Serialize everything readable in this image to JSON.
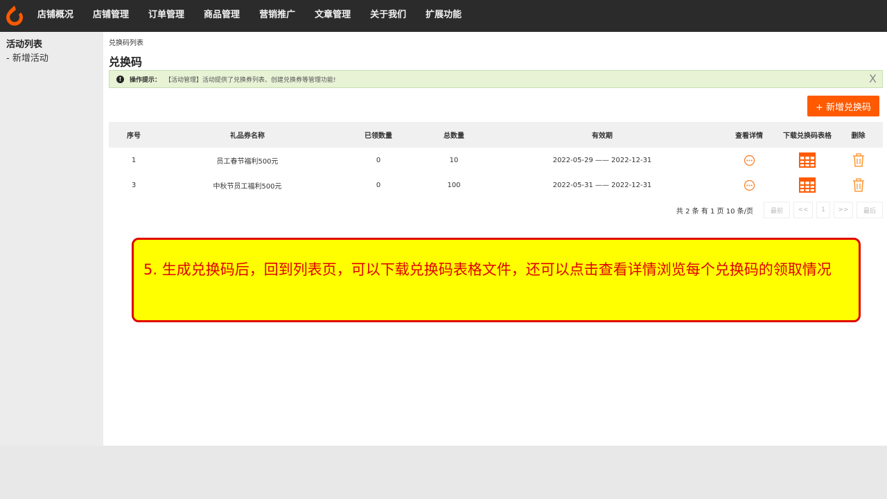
{
  "topnav": {
    "logo": "logo-icon",
    "items": [
      "店铺概况",
      "店铺管理",
      "订单管理",
      "商品管理",
      "营销推广",
      "文章管理",
      "关于我们",
      "扩展功能"
    ]
  },
  "sidebar": {
    "title": "活动列表",
    "links": [
      "- 新增活动"
    ]
  },
  "main": {
    "breadcrumb": "兑换码列表",
    "title": "兑换码",
    "tip": {
      "icon": "info-icon",
      "label": "操作提示：",
      "text": "【活动管理】活动提供了兑换券列表、创建兑换券等管理功能!",
      "close": "X"
    },
    "add_button": "+ 新增兑换码",
    "table": {
      "headers": [
        "序号",
        "礼品券名称",
        "已领数量",
        "总数量",
        "有效期",
        "查看详情",
        "下载兑换码表格",
        "删除"
      ],
      "rows": [
        {
          "id": "1",
          "name": "员工春节福利500元",
          "received": "0",
          "total": "10",
          "validity": "2022-05-29 —— 2022-12-31"
        },
        {
          "id": "3",
          "name": "中秋节员工福利500元",
          "received": "0",
          "total": "100",
          "validity": "2022-05-31 —— 2022-12-31"
        }
      ]
    },
    "pager": {
      "info": "共 2 条 有 1 页 10 条/页",
      "buttons": [
        "最前",
        "<<",
        "1",
        ">>",
        "最后"
      ]
    }
  },
  "callout": {
    "text": "5. 生成兑换码后，回到列表页，可以下载兑换码表格文件，还可以点击查看详情浏览每个兑换码的领取情况"
  },
  "colors": {
    "accent": "#ff5a00",
    "topbar": "#2b2b2b",
    "callout_bg": "#ffff00",
    "callout_border": "#e00000"
  }
}
